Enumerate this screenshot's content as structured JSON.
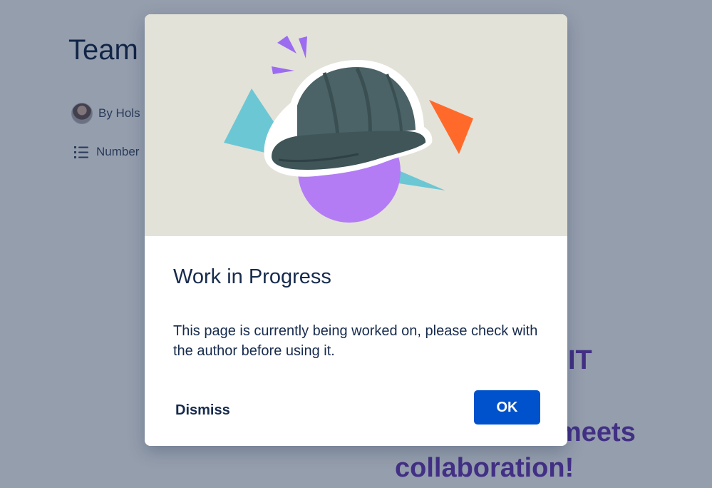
{
  "page": {
    "title": "Team",
    "byline": "By Hols",
    "numbered_label": "Number",
    "heading_fragments": [
      "ork’s  IT",
      "meets",
      "collaboration!"
    ]
  },
  "modal": {
    "title": "Work in Progress",
    "body": "This page is currently being worked on, please check with the author before using it.",
    "dismiss_label": "Dismiss",
    "ok_label": "OK",
    "illustration": "hard-hat-illustration"
  },
  "colors": {
    "primary_button": "#0052cc",
    "heading_purple": "#6e3fb9",
    "hero_background": "#e3e2d8",
    "text_dark": "#172b4d"
  }
}
